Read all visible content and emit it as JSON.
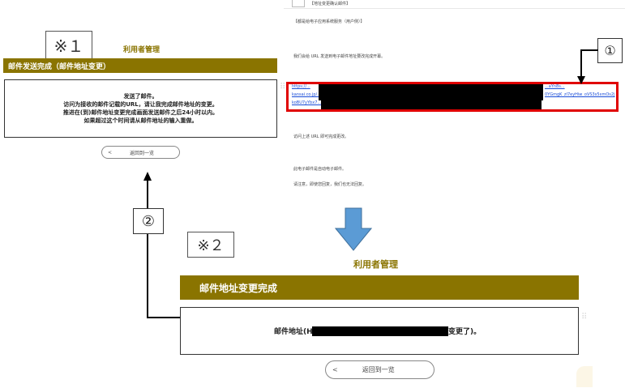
{
  "left_panel": {
    "note_label": "※１",
    "header_title": "利用者管理",
    "bar_title": "邮件发送完成（邮件地址变更）",
    "message_lines": [
      "发送了邮件。",
      "访问为接收的邮件记载的URL，请让我完成邮件地址的变更。",
      "推进在(到)邮件地址变更完成画面发送邮件之后24小时以内。",
      "如果超过这个时间请从邮件地址的输入重做。"
    ],
    "back_chevron": "<",
    "back_label": "返回到一览"
  },
  "email": {
    "subject": "【地址变更确认邮件】",
    "greeting": "【都是给电子应用系统服务（用户侧）】",
    "line1": "我们会给 URL 发送到电子邮件地址要改完成开幕。",
    "link_lines": [
      "https://...",
      "kansai.co.jp/...",
      "koBU7yYbx7..."
    ],
    "link_suffix_lines": [
      "...aYn8s...",
      "0YGmgK_zl7eyHiw_oVS3s5xmOs2j",
      ""
    ],
    "line2": "访问上述 URL 即可完成更改。",
    "line3": "此电子邮件是自动电子邮件。",
    "line4": "请注意，即使您回复，我们也无法回复。"
  },
  "markers": {
    "circle_1": "①",
    "circle_2": "②",
    "note_2": "※２"
  },
  "bottom_panel": {
    "header_title": "利用者管理",
    "bar_title": "邮件地址变更完成",
    "message_prefix": "邮件地址(H",
    "message_suffix": "变更了)。",
    "back_chevron": "<",
    "back_label": "返回到一览"
  },
  "colors": {
    "olive": "#8a7400",
    "arrow_blue": "#5b9bd5",
    "red_highlight": "#e00000",
    "link_blue": "#1a4dd8"
  }
}
